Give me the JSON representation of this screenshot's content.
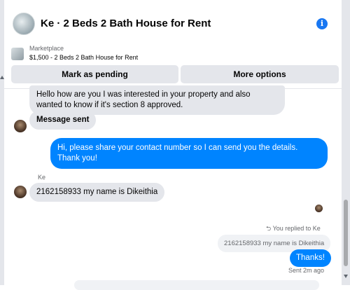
{
  "header": {
    "title": "Ke · 2 Beds 2 Bath House for Rent",
    "info_icon": "info-icon",
    "info_glyph": "i"
  },
  "marketplace": {
    "label": "Marketplace",
    "item": "$1,500 - 2 Beds 2 Bath House for Rent",
    "mark_pending": "Mark as pending",
    "more_options": "More options"
  },
  "messages": [
    {
      "text": "Hello how are you I was interested in your property and also wanted to know if it's section 8 approved.",
      "direction": "in"
    },
    {
      "text": "Message sent",
      "direction": "in"
    },
    {
      "text": "Hi, please share your contact number so I can send you the details. Thank you!",
      "direction": "out"
    },
    {
      "text": "2162158933 my name is Dikeithia",
      "direction": "in"
    },
    {
      "text": "2162158933 my name is Dikeithia",
      "direction": "quoted"
    },
    {
      "text": "Thanks!",
      "direction": "out"
    }
  ],
  "sender_name": "Ke",
  "replied_label": "You replied to Ke",
  "reply_glyph": "⮌",
  "sent_status": "Sent 2m ago",
  "colors": {
    "accent": "#0084ff",
    "incoming_bubble": "#e4e6eb",
    "info": "#1877f2"
  }
}
